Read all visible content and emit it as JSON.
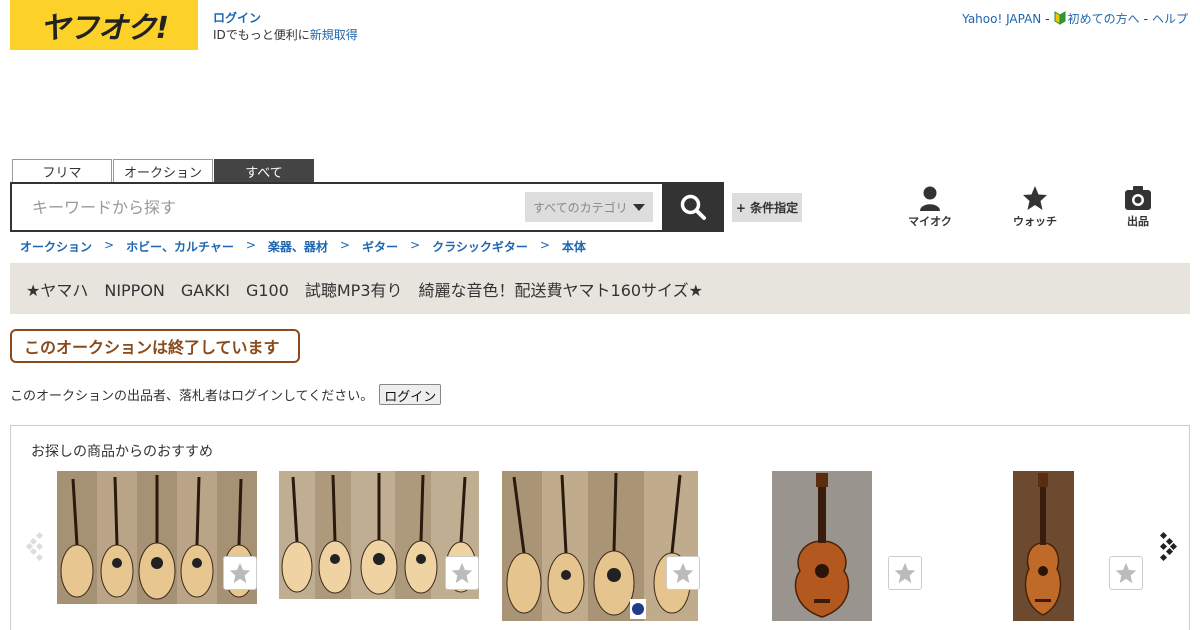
{
  "header": {
    "logo_text": "ヤフオク!",
    "login_label": "ログイン",
    "login_sub_prefix": "IDでもっと便利に",
    "signup_label": "新規取得",
    "links": [
      "Yahoo! JAPAN",
      "初めての方へ",
      "ヘルプ"
    ],
    "link_separator": "-"
  },
  "search": {
    "tabs": [
      "フリマ",
      "オークション",
      "すべて"
    ],
    "active_tab": 2,
    "placeholder": "キーワードから探す",
    "category_label": "すべてのカテゴリ",
    "advanced_label": "+ 条件指定"
  },
  "nav": {
    "my_label": "マイオク",
    "watch_label": "ウォッチ",
    "sell_label": "出品"
  },
  "breadcrumb": [
    "オークション",
    "ホビー、カルチャー",
    "楽器、器材",
    "ギター",
    "クラシックギター",
    "本体"
  ],
  "breadcrumb_separator": ">",
  "item": {
    "title": "★ヤマハ　NIPPON　GAKKI　G100　試聴MP3有り　綺麗な音色！配送費ヤマト160サイズ★",
    "ended_notice": "このオークションは終了しています",
    "login_prompt": "このオークションの出品者、落札者はログインしてください。",
    "login_button": "ログイン"
  },
  "recommendations": {
    "title": "お探しの商品からのおすすめ",
    "items": [
      {
        "image": "acoustic-guitars-photo"
      },
      {
        "image": "acoustic-guitars-photo"
      },
      {
        "image": "acoustic-guitars-photo"
      },
      {
        "image": "classical-guitar-photo"
      },
      {
        "image": "classical-guitar-photo"
      }
    ]
  },
  "colors": {
    "brand_yellow": "#fcd22a",
    "link_blue": "#1e66b0",
    "ended_brown": "#8a4b1c",
    "title_bar": "#e6e4dd"
  }
}
